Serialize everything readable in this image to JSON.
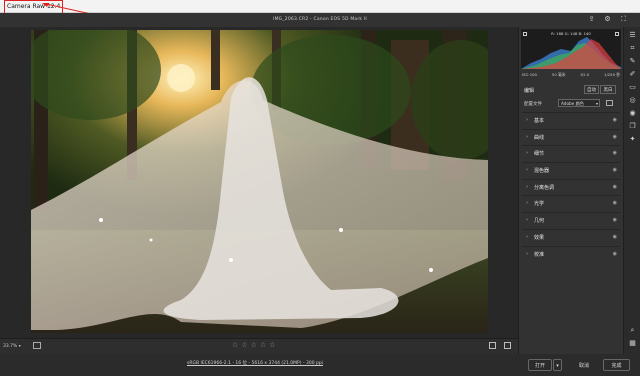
{
  "window": {
    "title": "Camera Raw 12.4"
  },
  "toolbar": {
    "file_info": "IMG_2063.CR2  -  Canon EOS 5D Mark II",
    "icons": [
      "share-icon",
      "settings-icon",
      "fullscreen-icon"
    ]
  },
  "histogram": {
    "readout": "R: 168   G: 148   B: 140"
  },
  "exif": {
    "iso": "ISO 100",
    "lens": "50 毫米",
    "aperture": "f/2.0",
    "shutter": "1/250 秒"
  },
  "edit": {
    "label": "编辑",
    "auto_label": "自动",
    "bw_label": "黑白"
  },
  "profile": {
    "label": "配置文件",
    "value": "Adobe 颜色"
  },
  "panels": [
    {
      "label": "基本"
    },
    {
      "label": "曲线"
    },
    {
      "label": "细节"
    },
    {
      "label": "混色器"
    },
    {
      "label": "分离色调"
    },
    {
      "label": "光学"
    },
    {
      "label": "几何"
    },
    {
      "label": "效果"
    },
    {
      "label": "校准"
    }
  ],
  "bottom": {
    "zoom": "33.7%",
    "stars": [
      "☆",
      "☆",
      "☆",
      "☆",
      "☆"
    ]
  },
  "footer": {
    "file_details": "sRGB IEC61966-2.1 - 16 位 - 5616 x 3744 (21.0MP) - 300 ppi",
    "open_label": "打开",
    "cancel_label": "取消",
    "done_label": "完成"
  },
  "colors": {
    "annotation_red": "#e02020",
    "panel_bg": "#323232",
    "canvas_bg": "#282828"
  }
}
